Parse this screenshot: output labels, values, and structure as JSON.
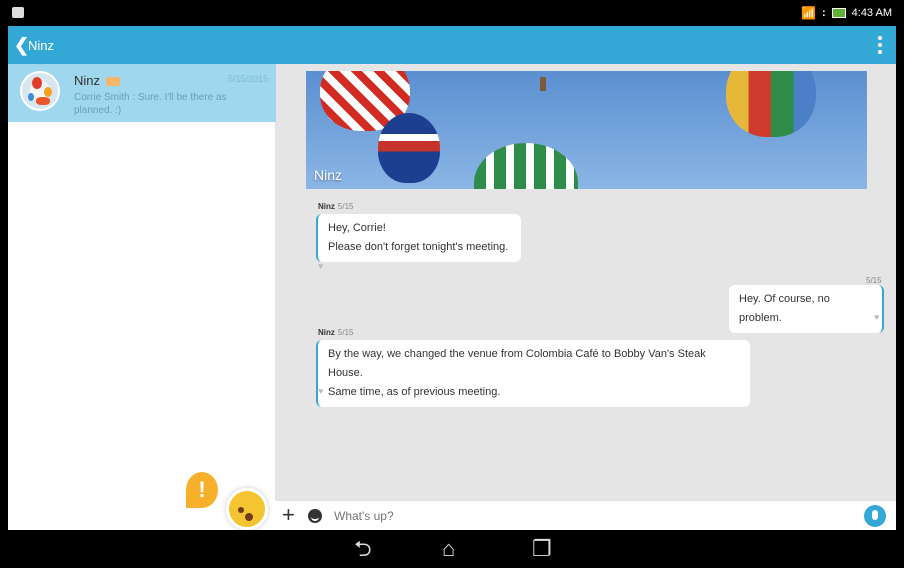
{
  "status_bar": {
    "time": "4:43 AM"
  },
  "action_bar": {
    "back_label": "❮",
    "title": "Ninz"
  },
  "conversation_list": [
    {
      "name": "Ninz",
      "date": "5/15/2015",
      "preview": "Corrie Smith : Sure. I'll be there as planned. :)"
    }
  ],
  "chat": {
    "banner_name": "Ninz",
    "messages": [
      {
        "sender": "Ninz",
        "date": "5/15",
        "lines": [
          "Hey, Corrie!",
          "Please don't forget tonight's meeting."
        ]
      },
      {
        "sender": "",
        "date": "5/15",
        "lines": [
          "Hey. Of course, no problem."
        ]
      },
      {
        "sender": "Ninz",
        "date": "5/15",
        "lines": [
          "By the way, we changed the venue from Colombia Café to Bobby Van's Steak House.",
          "Same time, as of previous meeting."
        ]
      }
    ]
  },
  "input": {
    "placeholder": "What's up?"
  },
  "nav": {
    "back": "⮌",
    "home": "⌂",
    "recents": "❐"
  },
  "colors": {
    "accent": "#33a8d6",
    "selected_row": "#9fd7ee"
  }
}
